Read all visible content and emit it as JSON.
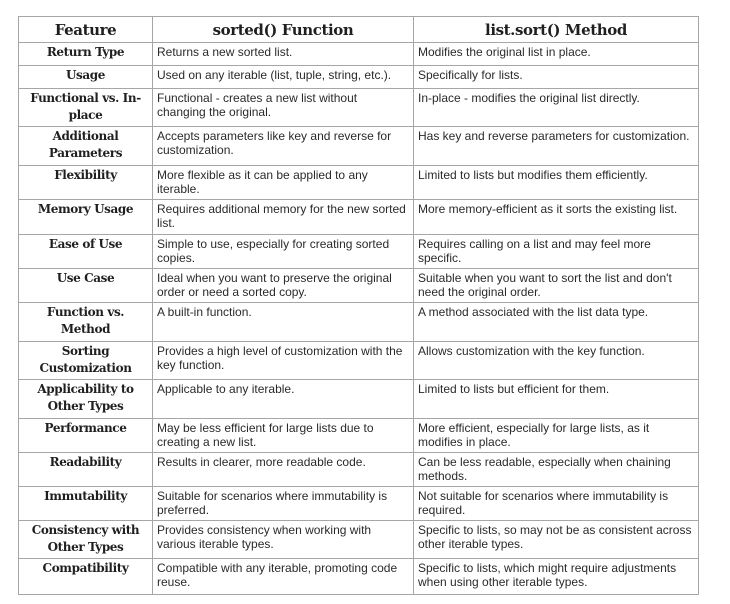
{
  "table": {
    "headers": [
      "Feature",
      "sorted() Function",
      "list.sort() Method"
    ],
    "rows": [
      {
        "feature": "Return Type",
        "sorted": "Returns a new sorted list.",
        "sort": "Modifies the original list in place."
      },
      {
        "feature": "Usage",
        "sorted": "Used on any iterable (list, tuple, string, etc.).",
        "sort": "Specifically for lists."
      },
      {
        "feature": "Functional vs. In-place",
        "sorted": "Functional - creates a new list without changing the original.",
        "sort": "In-place - modifies the original list directly."
      },
      {
        "feature": "Additional Parameters",
        "sorted": "Accepts parameters like key and reverse for customization.",
        "sort": "Has key and reverse parameters for customization."
      },
      {
        "feature": "Flexibility",
        "sorted": "More flexible as it can be applied to any iterable.",
        "sort": "Limited to lists but modifies them efficiently."
      },
      {
        "feature": "Memory Usage",
        "sorted": "Requires additional memory for the new sorted list.",
        "sort": "More memory-efficient as it sorts the existing list."
      },
      {
        "feature": "Ease of Use",
        "sorted": "Simple to use, especially for creating sorted copies.",
        "sort": "Requires calling on a list and may feel more specific."
      },
      {
        "feature": "Use Case",
        "sorted": "Ideal when you want to preserve the original order or need a sorted copy.",
        "sort": "Suitable when you want to sort the list and don't need the original order."
      },
      {
        "feature": "Function vs. Method",
        "sorted": "A built-in function.",
        "sort": "A method associated with the list data type."
      },
      {
        "feature": "Sorting Customization",
        "sorted": "Provides a high level of customization with the key function.",
        "sort": "Allows customization with the key function."
      },
      {
        "feature": "Applicability to Other Types",
        "sorted": "Applicable to any iterable.",
        "sort": "Limited to lists but efficient for them."
      },
      {
        "feature": "Performance",
        "sorted": "May be less efficient for large lists due to creating a new list.",
        "sort": "More efficient, especially for large lists, as it modifies in place."
      },
      {
        "feature": "Readability",
        "sorted": "Results in clearer, more readable code.",
        "sort": "Can be less readable, especially when chaining methods."
      },
      {
        "feature": "Immutability",
        "sorted": "Suitable for scenarios where immutability is preferred.",
        "sort": "Not suitable for scenarios where immutability is required."
      },
      {
        "feature": "Consistency with Other Types",
        "sorted": "Provides consistency when working with various iterable types.",
        "sort": "Specific to lists, so may not be as consistent across other iterable types."
      },
      {
        "feature": "Compatibility",
        "sorted": "Compatible with any iterable, promoting code reuse.",
        "sort": "Specific to lists, which might require adjustments when using other iterable types."
      }
    ]
  }
}
